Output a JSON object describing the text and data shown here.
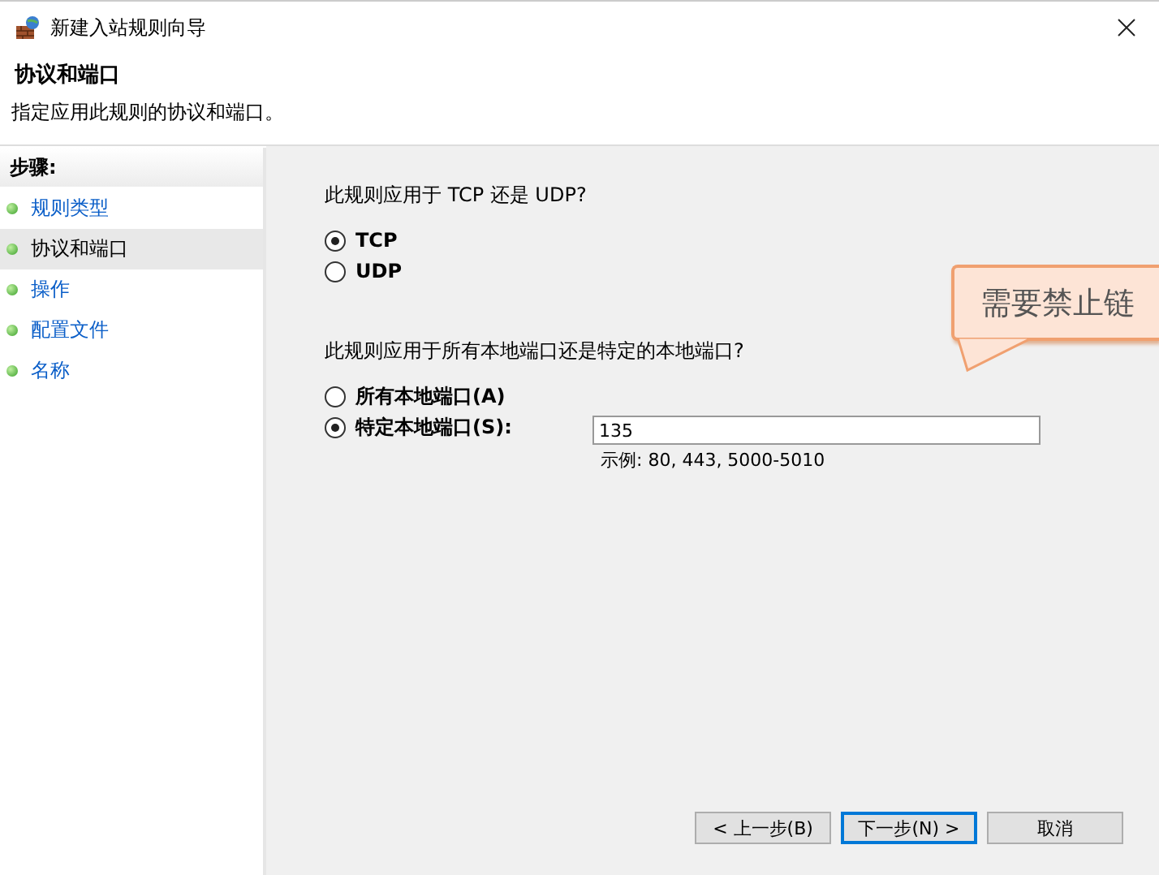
{
  "window": {
    "title": "新建入站规则向导"
  },
  "header": {
    "title": "协议和端口",
    "subtitle": "指定应用此规则的协议和端口。"
  },
  "sidebar": {
    "heading": "步骤:",
    "items": [
      {
        "label": "规则类型",
        "selected": false
      },
      {
        "label": "协议和端口",
        "selected": true
      },
      {
        "label": "操作",
        "selected": false
      },
      {
        "label": "配置文件",
        "selected": false
      },
      {
        "label": "名称",
        "selected": false
      }
    ]
  },
  "protocol": {
    "question": "此规则应用于 TCP 还是 UDP?",
    "options": [
      {
        "label": "TCP",
        "selected": true
      },
      {
        "label": "UDP",
        "selected": false
      }
    ]
  },
  "ports": {
    "question": "此规则应用于所有本地端口还是特定的本地端口?",
    "options": [
      {
        "label": "所有本地端口(A)",
        "selected": false
      },
      {
        "label": "特定本地端口(S):",
        "selected": true
      }
    ],
    "value": "135",
    "hint": "示例: 80, 443, 5000-5010"
  },
  "callout": {
    "text": "需要禁止链"
  },
  "buttons": [
    {
      "label": "< 上一步(B)",
      "selected": false
    },
    {
      "label": "下一步(N) >",
      "selected": true
    },
    {
      "label": "取消",
      "selected": false
    }
  ]
}
